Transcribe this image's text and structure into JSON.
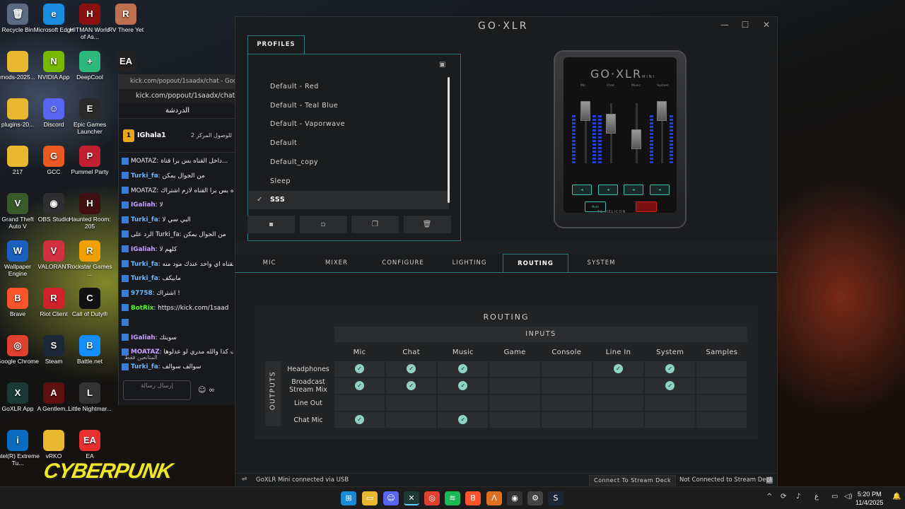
{
  "desktop": {
    "icons": [
      {
        "label": "Recycle Bin",
        "name": "recycle-bin-icon",
        "color": "#5a6a80",
        "glyph": "🗑"
      },
      {
        "label": "Microsoft Edge",
        "name": "edge-icon",
        "color": "#1b8de0",
        "glyph": "e"
      },
      {
        "label": "HITMAN World of As...",
        "name": "hitman-icon",
        "color": "#8a1010",
        "glyph": "H"
      },
      {
        "label": "RV There Yet",
        "name": "rv-there-yet-icon",
        "color": "#c07050",
        "glyph": "R"
      },
      {
        "label": "mods-2025...",
        "name": "folder-icon",
        "color": "#e8b830",
        "glyph": ""
      },
      {
        "label": "NVIDIA App",
        "name": "nvidia-icon",
        "color": "#76b900",
        "glyph": "N"
      },
      {
        "label": "DeepCool",
        "name": "deepcool-icon",
        "color": "#2db87c",
        "glyph": "+"
      },
      {
        "label": "EA...",
        "name": "ea-icon-small",
        "color": "#222",
        "glyph": "EA"
      },
      {
        "label": "plugins-20...",
        "name": "folder-icon",
        "color": "#e8b830",
        "glyph": ""
      },
      {
        "label": "Discord",
        "name": "discord-icon",
        "color": "#5865f2",
        "glyph": "☺"
      },
      {
        "label": "Epic Games Launcher",
        "name": "epic-games-icon",
        "color": "#2a2a2a",
        "glyph": "E"
      },
      {
        "label": "217",
        "name": "folder-icon",
        "color": "#e8b830",
        "glyph": ""
      },
      {
        "label": "GCC",
        "name": "gcc-icon",
        "color": "#e85a20",
        "glyph": "G"
      },
      {
        "label": "Pummel Party",
        "name": "pummel-party-icon",
        "color": "#c02030",
        "glyph": "P"
      },
      {
        "label": "Grand Theft Auto V",
        "name": "gta-icon",
        "color": "#3a5a2a",
        "glyph": "V"
      },
      {
        "label": "OBS Studio",
        "name": "obs-icon",
        "color": "#302e31",
        "glyph": "◉"
      },
      {
        "label": "Haunted Room: 205",
        "name": "haunted-room-icon",
        "color": "#401010",
        "glyph": "H"
      },
      {
        "label": "Wallpaper Engine",
        "name": "wallpaper-engine-icon",
        "color": "#1a60c0",
        "glyph": "W"
      },
      {
        "label": "VALORANT",
        "name": "valorant-icon",
        "color": "#d03040",
        "glyph": "V"
      },
      {
        "label": "Rockstar Games ...",
        "name": "rockstar-icon",
        "color": "#f0a000",
        "glyph": "R"
      },
      {
        "label": "Brave",
        "name": "brave-icon",
        "color": "#fb542b",
        "glyph": "B"
      },
      {
        "label": "Riot Client",
        "name": "riot-client-icon",
        "color": "#d0202a",
        "glyph": "R"
      },
      {
        "label": "Call of Duty®",
        "name": "call-of-duty-icon",
        "color": "#111",
        "glyph": "C"
      },
      {
        "label": "Google Chrome",
        "name": "chrome-icon",
        "color": "#e04030",
        "glyph": "◎"
      },
      {
        "label": "Steam",
        "name": "steam-icon",
        "color": "#1b2838",
        "glyph": "S"
      },
      {
        "label": "Battle.net",
        "name": "battlenet-icon",
        "color": "#148eff",
        "glyph": "B"
      },
      {
        "label": "GoXLR App",
        "name": "goxlr-app-icon",
        "color": "#1a3a36",
        "glyph": "X"
      },
      {
        "label": "A Gentlem...",
        "name": "gentleman-icon",
        "color": "#601010",
        "glyph": "A"
      },
      {
        "label": "Little Nightmar...",
        "name": "little-nightmares-icon",
        "color": "#333",
        "glyph": "L"
      },
      {
        "label": "Intel(R) Extreme Tu...",
        "name": "intel-xtu-icon",
        "color": "#0a6ac0",
        "glyph": "i"
      },
      {
        "label": "vRKO",
        "name": "folder-icon",
        "color": "#e8b830",
        "glyph": ""
      },
      {
        "label": "EA",
        "name": "ea-icon",
        "color": "#e83030",
        "glyph": "EA"
      }
    ],
    "wallpaper_text": "CYBERPUNK"
  },
  "chat": {
    "tab_title": "kick.com/popout/1saadx/chat - Goo...",
    "url": "kick.com/popout/1saadx/chat",
    "header": "الدردشة",
    "pinned_user": "IGhala1",
    "pinned_rank": "1",
    "pinned_text": "للوصول المركز 2",
    "messages": [
      {
        "user": "",
        "text": "MOATAZ: داخل القناه بس برا قناة...",
        "cls": "u3"
      },
      {
        "user": "Turki_fa",
        "text": ": من الجوال يمكن",
        "cls": "u"
      },
      {
        "user": "",
        "text": "MOATAZ: داخل القناه بس برا القناه لازم اشتراك",
        "cls": "u3"
      },
      {
        "user": "IGaliah",
        "text": ": لا",
        "cls": "u3"
      },
      {
        "user": "Turki_fa",
        "text": ": البي سي لا",
        "cls": "u"
      },
      {
        "user": "",
        "text": "الرد على Turki_fa: من الجوال يمكن",
        "cls": "u3"
      },
      {
        "user": "IGaliah",
        "text": ": كلهم لا",
        "cls": "u3"
      },
      {
        "user": "Turki_fa",
        "text": ": ادخل لقناه اي واحد عندك مود منه",
        "cls": "u"
      },
      {
        "user": "Turki_fa",
        "text": ": مابيكف",
        "cls": "u"
      },
      {
        "user": "97758",
        "text": ": اشتراك !",
        "cls": "u"
      },
      {
        "user": "BotRix",
        "text": ": https://kick.com/1saad",
        "cls": "u2"
      },
      {
        "user": "",
        "text": "",
        "cls": "u"
      },
      {
        "user": "IGaliah",
        "text": ": سويتك",
        "cls": "u3"
      },
      {
        "user": "MOATAZ",
        "text": ": كانت كذا والله مدري لو عدلوها",
        "cls": "u3"
      },
      {
        "user": "Turki_fa",
        "text": ": سوالف سوالف",
        "cls": "u"
      }
    ],
    "followers_label": "المتابعين فقط",
    "input_placeholder": "إرسال رسالة"
  },
  "goxlr": {
    "window_title": "GO·XLR",
    "profiles_tab": "PROFILES",
    "profiles": [
      {
        "label": "Default - Red",
        "selected": false
      },
      {
        "label": "Default - Teal Blue",
        "selected": false
      },
      {
        "label": "Default - Vaporwave",
        "selected": false
      },
      {
        "label": "Default",
        "selected": false
      },
      {
        "label": "Default_copy",
        "selected": false
      },
      {
        "label": "Sleep",
        "selected": false
      },
      {
        "label": "SSS",
        "selected": true
      }
    ],
    "profile_buttons": [
      {
        "name": "save-profile-button",
        "glyph": "▪"
      },
      {
        "name": "new-profile-button",
        "glyph": "▫"
      },
      {
        "name": "copy-profile-button",
        "glyph": "❐"
      },
      {
        "name": "delete-profile-button",
        "glyph": "🗑"
      }
    ],
    "device": {
      "logo": "GO·XLR",
      "logo_sub": "MINI",
      "channels": [
        "Mic",
        "Chat",
        "Music",
        "System"
      ],
      "brand": "TC·HELICON",
      "fx_label": "Mute"
    },
    "tabs": [
      {
        "label": "MIC",
        "active": false
      },
      {
        "label": "MIXER",
        "active": false
      },
      {
        "label": "CONFIGURE",
        "active": false
      },
      {
        "label": "LIGHTING",
        "active": false
      },
      {
        "label": "ROUTING",
        "active": true
      },
      {
        "label": "SYSTEM",
        "active": false
      }
    ],
    "routing": {
      "title": "ROUTING",
      "inputs_label": "INPUTS",
      "outputs_label": "OUTPUTS",
      "inputs": [
        "Mic",
        "Chat",
        "Music",
        "Game",
        "Console",
        "Line In",
        "System",
        "Samples"
      ],
      "outputs": [
        {
          "label": "Headphones",
          "routes": [
            true,
            true,
            true,
            false,
            false,
            true,
            true,
            false
          ]
        },
        {
          "label": "Broadcast Stream Mix",
          "routes": [
            true,
            true,
            true,
            false,
            false,
            false,
            true,
            false
          ]
        },
        {
          "label": "Line Out",
          "routes": [
            false,
            false,
            false,
            false,
            false,
            false,
            false,
            false
          ]
        },
        {
          "label": "Chat Mic",
          "routes": [
            true,
            false,
            true,
            false,
            false,
            false,
            false,
            false
          ]
        }
      ]
    },
    "status": {
      "connection": "GoXLR Mini connected via USB",
      "stream_deck_button": "Connect To Stream Deck",
      "stream_deck_status": "Not Connected to Stream Deck"
    }
  },
  "taskbar": {
    "time": "5:20 PM",
    "date": "11/4/2025",
    "lang": "ع"
  }
}
